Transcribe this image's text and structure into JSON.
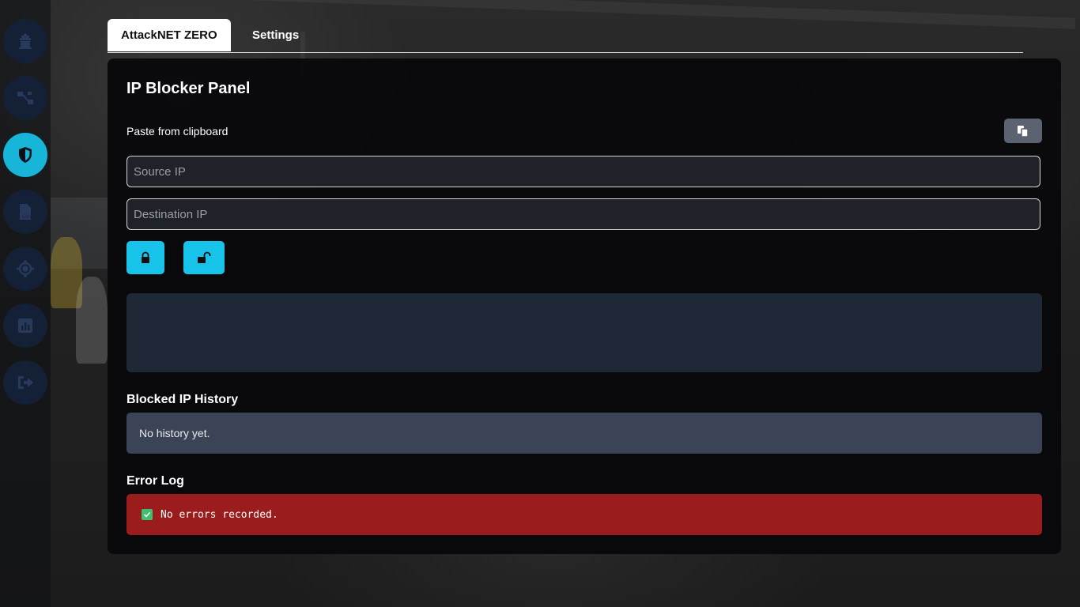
{
  "sidebar": {
    "items": [
      {
        "name": "attack-icon"
      },
      {
        "name": "network-icon"
      },
      {
        "name": "shield-icon",
        "active": true
      },
      {
        "name": "csv-file-icon"
      },
      {
        "name": "crosshair-icon"
      },
      {
        "name": "chart-icon"
      },
      {
        "name": "logout-icon"
      }
    ]
  },
  "tabs": {
    "active_label": "AttackNET ZERO",
    "settings_label": "Settings"
  },
  "panel": {
    "title": "IP Blocker Panel",
    "paste_label": "Paste from clipboard",
    "paste_icon": "clipboard-copy-icon",
    "source_placeholder": "Source IP",
    "destination_placeholder": "Destination IP",
    "lock_icon": "lock-icon",
    "unlock_icon": "unlock-icon",
    "history_title": "Blocked IP History",
    "history_empty": "No history yet.",
    "error_title": "Error Log",
    "error_message": "No errors recorded."
  },
  "colors": {
    "accent": "#17c3e8",
    "active_nav": "#17b5d8",
    "nav_bg": "#142036",
    "error_bg": "#9b1c1c",
    "history_bg": "#3a4456"
  }
}
